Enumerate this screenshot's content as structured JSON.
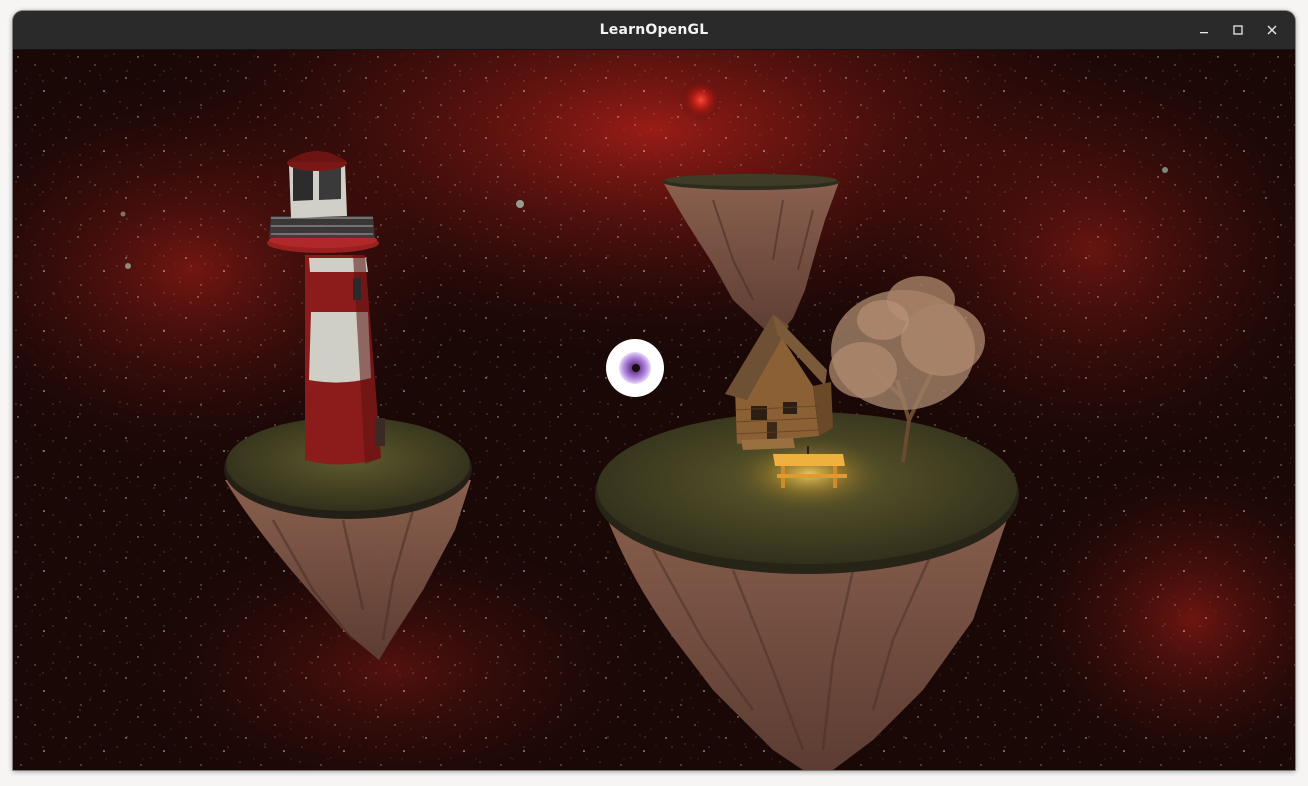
{
  "window": {
    "title": "LearnOpenGL",
    "controls": {
      "minimize": "minimize-icon",
      "maximize": "maximize-icon",
      "close": "close-icon"
    }
  },
  "scene": {
    "background_color": "#1a0807",
    "nebula_color": "#8c1a14",
    "rock_color": "#7a5446",
    "grass_color": "#3a3a22",
    "lamp_glow_color": "#ffc84a",
    "lighthouse_red": "#8c1c1c",
    "lighthouse_white": "#cfcfc5",
    "eye_color": "#9a6cc8"
  }
}
